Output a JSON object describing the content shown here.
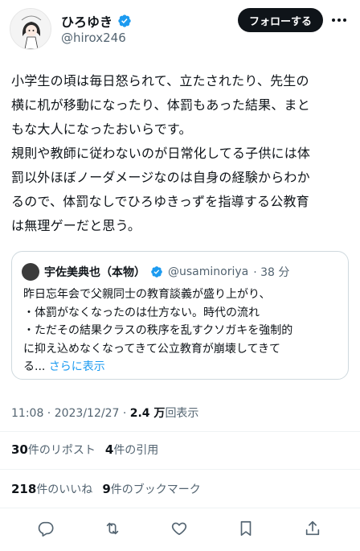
{
  "user": {
    "display_name": "ひろゆき",
    "handle": "@hirox246",
    "follow_label": "フォローする"
  },
  "tweet": {
    "lines": [
      "小学生の頃は毎日怒られて、立たされたり、先生の",
      "横に机が移動になったり、体罰もあった結果、まと",
      "もな大人になったおいらです。",
      "規則や教師に従わないのが日常化してる子供には体",
      "罰以外ほぼノーダメージなのは自身の経験からわか",
      "るので、体罰なしでひろゆきっずを指導する公教育",
      "は無理ゲーだと思う。"
    ]
  },
  "quote": {
    "name": "宇佐美典也（本物）",
    "handle": "@usaminoriya",
    "time": "· 38 分",
    "lines": [
      "昨日忘年会で父親同士の教育談義が盛り上がり、",
      "・体罰がなくなったのは仕方ない。時代の流れ",
      "・ただその結果クラスの秩序を乱すクソガキを強制的",
      "に抑え込めなくなってきて公立教育が崩壊してきて"
    ],
    "last_line": "る...",
    "show_more": "さらに表示"
  },
  "meta": {
    "time": "11:08 · 2023/12/27 · ",
    "views_count": "2.4 万",
    "views_label": "回表示"
  },
  "stats": {
    "reposts_count": "30",
    "reposts_label": "件のリポスト",
    "quotes_count": "4",
    "quotes_label": "件の引用",
    "likes_count": "218",
    "likes_label": "件のいいね",
    "bookmarks_count": "9",
    "bookmarks_label": "件のブックマーク"
  },
  "colors": {
    "accent": "#1d9bf0",
    "text": "#0f1419",
    "muted": "#536471",
    "border": "#cfd9de"
  },
  "icons": [
    "verified-badge-icon",
    "more-icon",
    "reply-icon",
    "repost-icon",
    "like-icon",
    "bookmark-icon",
    "share-icon"
  ]
}
